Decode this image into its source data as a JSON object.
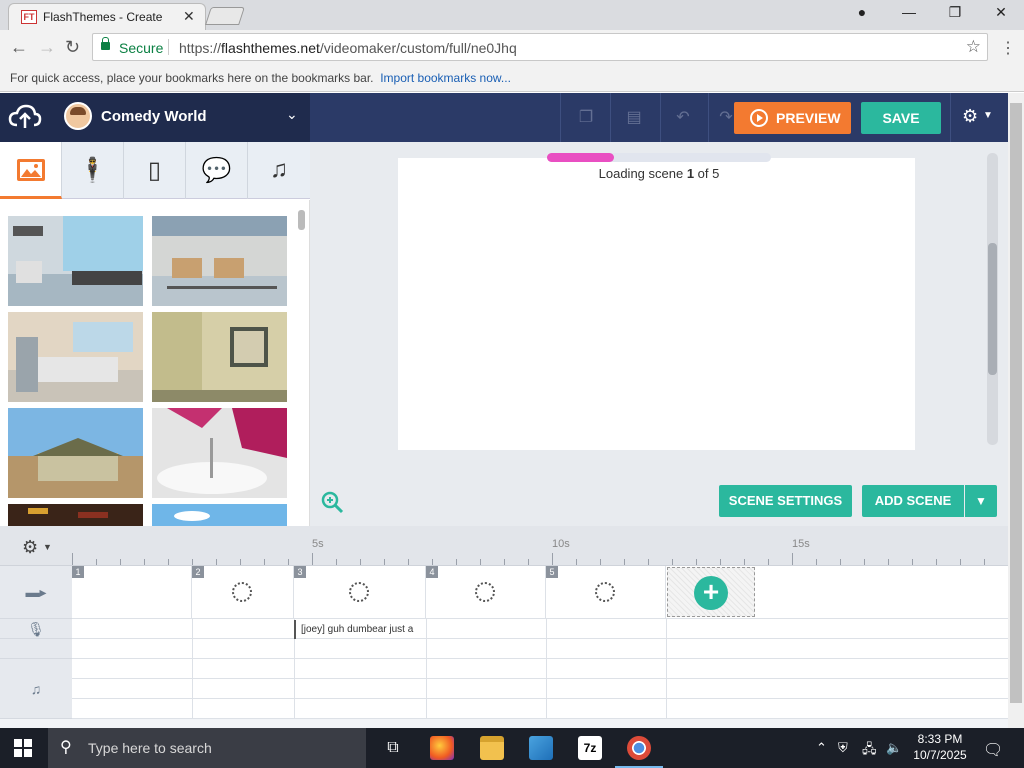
{
  "browser": {
    "tab_title": "FlashThemes - Create",
    "favicon_text": "FT",
    "secure_label": "Secure",
    "url_prefix": "https://",
    "url_domain": "flashthemes.net",
    "url_path": "/videomaker/custom/full/ne0Jhq",
    "bookmarks_hint": "For quick access, place your bookmarks here on the bookmarks bar.",
    "import_link": "Import bookmarks now..."
  },
  "app": {
    "theme_name": "Comedy World",
    "preview_label": "PREVIEW",
    "save_label": "SAVE",
    "asset_tabs": [
      "background-icon",
      "character-icon",
      "prop-icon",
      "speech-icon",
      "music-icon"
    ]
  },
  "stage": {
    "loading_prefix": "Loading scene ",
    "loading_current": "1",
    "loading_suffix": " of 5",
    "progress_fraction": 0.3,
    "scene_settings_label": "SCENE SETTINGS",
    "add_scene_label": "ADD SCENE"
  },
  "timeline": {
    "ruler_labels": [
      "5s",
      "10s",
      "15s"
    ],
    "scenes": [
      "1",
      "2",
      "3",
      "4",
      "5"
    ],
    "voice_clip": "[joey] guh dumbear just a"
  },
  "taskbar": {
    "search_placeholder": "Type here to search",
    "time": "8:33 PM",
    "date": "10/7/2025",
    "sevenzip_label": "7z"
  },
  "colors": {
    "accent_orange": "#f37a30",
    "accent_teal": "#2bb89e",
    "progress_pink": "#e94fc2",
    "header_navy": "#2b3a67"
  }
}
